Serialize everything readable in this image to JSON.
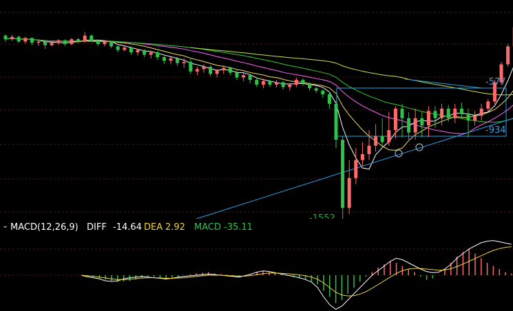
{
  "colors": {
    "up": "#ff6a6a",
    "down": "#2ec24a",
    "ma5": "#ffffff",
    "ma10": "#f0e060",
    "ma20": "#ff66ff",
    "ma30": "#33cc33",
    "ma60": "#c8e84a",
    "trend": "#29a3e6",
    "grid": "#3a1a1a",
    "label_low": "#1fae3a",
    "label_level": "#3aa0e8",
    "text": "#ffffff",
    "dea": "#f0d440",
    "macd": "#2ec24a"
  },
  "price_labels": {
    "low": "-1552",
    "level_upper": "-577",
    "level_lower": "-934"
  },
  "indicator": {
    "name": "MACD(12,26,9)",
    "diff_label": "DIFF",
    "diff_value": "-14.64",
    "dea_label": "DEA",
    "dea_value": "2.92",
    "macd_label": "MACD",
    "macd_value": "-35.11",
    "toggle_icon": "chevron-down-icon"
  },
  "chart_data": {
    "type": "candlestick",
    "title": "",
    "note": "Main-pane price values are relative (same units as the printed -1552 / -577 / -934 markers); lower pane is the MACD histogram.",
    "candles": [
      {
        "o": -10,
        "c": -40,
        "h": 0,
        "l": -60
      },
      {
        "o": -40,
        "c": -20,
        "h": -5,
        "l": -55
      },
      {
        "o": -20,
        "c": -60,
        "h": -10,
        "l": -70
      },
      {
        "o": -60,
        "c": -30,
        "h": -20,
        "l": -75
      },
      {
        "o": -30,
        "c": -70,
        "h": -25,
        "l": -90
      },
      {
        "o": -70,
        "c": -60,
        "h": -50,
        "l": -95
      },
      {
        "o": -60,
        "c": -90,
        "h": -45,
        "l": -120
      },
      {
        "o": -90,
        "c": -70,
        "h": -60,
        "l": -100
      },
      {
        "o": -70,
        "c": -50,
        "h": -40,
        "l": -85
      },
      {
        "o": -50,
        "c": -80,
        "h": -40,
        "l": -95
      },
      {
        "o": -80,
        "c": -40,
        "h": -30,
        "l": -90
      },
      {
        "o": -40,
        "c": -60,
        "h": -30,
        "l": -75
      },
      {
        "o": -60,
        "c": -10,
        "h": 20,
        "l": -70
      },
      {
        "o": -10,
        "c": -50,
        "h": 0,
        "l": -60
      },
      {
        "o": -50,
        "c": -80,
        "h": -40,
        "l": -95
      },
      {
        "o": -80,
        "c": -60,
        "h": -50,
        "l": -100
      },
      {
        "o": -60,
        "c": -100,
        "h": -55,
        "l": -115
      },
      {
        "o": -100,
        "c": -130,
        "h": -90,
        "l": -150
      },
      {
        "o": -130,
        "c": -110,
        "h": -95,
        "l": -140
      },
      {
        "o": -110,
        "c": -150,
        "h": -100,
        "l": -170
      },
      {
        "o": -150,
        "c": -130,
        "h": -120,
        "l": -175
      },
      {
        "o": -130,
        "c": -170,
        "h": -125,
        "l": -190
      },
      {
        "o": -170,
        "c": -150,
        "h": -140,
        "l": -200
      },
      {
        "o": -150,
        "c": -190,
        "h": -140,
        "l": -215
      },
      {
        "o": -190,
        "c": -220,
        "h": -180,
        "l": -245
      },
      {
        "o": -220,
        "c": -200,
        "h": -190,
        "l": -250
      },
      {
        "o": -200,
        "c": -240,
        "h": -190,
        "l": -265
      },
      {
        "o": -240,
        "c": -230,
        "h": -200,
        "l": -280
      },
      {
        "o": -230,
        "c": -310,
        "h": -210,
        "l": -330
      },
      {
        "o": -310,
        "c": -290,
        "h": -270,
        "l": -340
      },
      {
        "o": -290,
        "c": -270,
        "h": -250,
        "l": -320
      },
      {
        "o": -270,
        "c": -330,
        "h": -260,
        "l": -350
      },
      {
        "o": -330,
        "c": -300,
        "h": -290,
        "l": -360
      },
      {
        "o": -300,
        "c": -280,
        "h": -260,
        "l": -330
      },
      {
        "o": -280,
        "c": -320,
        "h": -270,
        "l": -340
      },
      {
        "o": -320,
        "c": -360,
        "h": -300,
        "l": -380
      },
      {
        "o": -360,
        "c": -340,
        "h": -320,
        "l": -390
      },
      {
        "o": -340,
        "c": -380,
        "h": -330,
        "l": -410
      },
      {
        "o": -380,
        "c": -420,
        "h": -360,
        "l": -440
      },
      {
        "o": -420,
        "c": -390,
        "h": -370,
        "l": -450
      },
      {
        "o": -390,
        "c": -420,
        "h": -380,
        "l": -440
      },
      {
        "o": -420,
        "c": -400,
        "h": -380,
        "l": -445
      },
      {
        "o": -400,
        "c": -440,
        "h": -390,
        "l": -460
      },
      {
        "o": -440,
        "c": -420,
        "h": -410,
        "l": -470
      },
      {
        "o": -420,
        "c": -380,
        "h": -360,
        "l": -440
      },
      {
        "o": -380,
        "c": -410,
        "h": -370,
        "l": -430
      },
      {
        "o": -410,
        "c": -450,
        "h": -400,
        "l": -470
      },
      {
        "o": -450,
        "c": -470,
        "h": -440,
        "l": -490
      },
      {
        "o": -470,
        "c": -500,
        "h": -460,
        "l": -530
      },
      {
        "o": -500,
        "c": -580,
        "h": -480,
        "l": -620
      },
      {
        "o": -580,
        "c": -880,
        "h": -560,
        "l": -950
      },
      {
        "o": -880,
        "c": -1450,
        "h": -850,
        "l": -1552
      },
      {
        "o": -1450,
        "c": -1200,
        "h": -1050,
        "l": -1500
      },
      {
        "o": -1200,
        "c": -1050,
        "h": -950,
        "l": -1250
      },
      {
        "o": -1050,
        "c": -1000,
        "h": -900,
        "l": -1100
      },
      {
        "o": -1000,
        "c": -930,
        "h": -800,
        "l": -1050
      },
      {
        "o": -930,
        "c": -850,
        "h": -750,
        "l": -980
      },
      {
        "o": -850,
        "c": -900,
        "h": -700,
        "l": -950
      },
      {
        "o": -900,
        "c": -800,
        "h": -650,
        "l": -930
      },
      {
        "o": -800,
        "c": -620,
        "h": -600,
        "l": -870
      },
      {
        "o": -620,
        "c": -700,
        "h": -580,
        "l": -860
      },
      {
        "o": -700,
        "c": -820,
        "h": -650,
        "l": -880
      },
      {
        "o": -820,
        "c": -700,
        "h": -620,
        "l": -880
      },
      {
        "o": -700,
        "c": -760,
        "h": -650,
        "l": -860
      },
      {
        "o": -760,
        "c": -640,
        "h": -600,
        "l": -860
      },
      {
        "o": -640,
        "c": -700,
        "h": -600,
        "l": -780
      },
      {
        "o": -700,
        "c": -620,
        "h": -580,
        "l": -760
      },
      {
        "o": -620,
        "c": -700,
        "h": -590,
        "l": -730
      },
      {
        "o": -700,
        "c": -620,
        "h": -580,
        "l": -740
      },
      {
        "o": -620,
        "c": -660,
        "h": -570,
        "l": -700
      },
      {
        "o": -660,
        "c": -720,
        "h": -620,
        "l": -860
      },
      {
        "o": -720,
        "c": -680,
        "h": -640,
        "l": -760
      },
      {
        "o": -680,
        "c": -620,
        "h": -580,
        "l": -720
      },
      {
        "o": -620,
        "c": -560,
        "h": -540,
        "l": -640
      },
      {
        "o": -560,
        "c": -400,
        "h": -380,
        "l": -580
      },
      {
        "o": -400,
        "c": -250,
        "h": -230,
        "l": -420
      },
      {
        "o": -250,
        "c": -100,
        "h": -80,
        "l": -270
      },
      {
        "o": -100,
        "c": 60,
        "h": 80,
        "l": -120
      },
      {
        "o": 60,
        "c": 250,
        "h": 300,
        "l": 40
      },
      {
        "o": 250,
        "c": 200,
        "h": 320,
        "l": 160
      }
    ],
    "macd_hist": [
      0,
      -3,
      -6,
      -10,
      -14,
      -18,
      -22,
      -20,
      -18,
      -14,
      -8,
      -4,
      -6,
      -10,
      -14,
      -12,
      -6,
      0,
      3,
      6,
      8,
      10,
      6,
      4,
      2,
      -2,
      -6,
      -4,
      4,
      10,
      14,
      10,
      6,
      2,
      -2,
      -6,
      -10,
      -14,
      -20,
      -30,
      -50,
      -70,
      -90,
      -80,
      -60,
      -40,
      -20,
      -5,
      10,
      25,
      35,
      45,
      40,
      30,
      20,
      10,
      -5,
      -15,
      -10,
      0,
      20,
      40,
      60,
      75,
      85,
      70,
      55,
      40,
      30,
      20,
      10,
      5
    ],
    "diff": [
      0,
      -5,
      -8,
      -12,
      -18,
      -20,
      -18,
      -12,
      -8,
      -6,
      -4,
      -6,
      -8,
      -10,
      -12,
      -10,
      -6,
      -4,
      -2,
      0,
      2,
      4,
      2,
      0,
      -2,
      -4,
      -6,
      -2,
      4,
      10,
      14,
      12,
      8,
      4,
      0,
      -4,
      -8,
      -14,
      -22,
      -40,
      -70,
      -95,
      -110,
      -100,
      -80,
      -60,
      -40,
      -20,
      0,
      15,
      30,
      45,
      55,
      50,
      40,
      30,
      20,
      12,
      8,
      10,
      20,
      35,
      55,
      70,
      85,
      95,
      105,
      110,
      112,
      108,
      104,
      100
    ],
    "dea": [
      0,
      -2,
      -4,
      -6,
      -9,
      -12,
      -14,
      -14,
      -13,
      -11,
      -9,
      -8,
      -8,
      -9,
      -10,
      -10,
      -9,
      -8,
      -6,
      -4,
      -2,
      0,
      0,
      0,
      -1,
      -2,
      -3,
      -3,
      -1,
      2,
      5,
      7,
      7,
      6,
      5,
      3,
      1,
      -2,
      -6,
      -13,
      -25,
      -40,
      -55,
      -64,
      -67,
      -66,
      -61,
      -53,
      -42,
      -30,
      -18,
      -6,
      6,
      15,
      20,
      22,
      22,
      20,
      18,
      16,
      17,
      21,
      28,
      36,
      45,
      54,
      63,
      72,
      80,
      86,
      90,
      92
    ]
  }
}
